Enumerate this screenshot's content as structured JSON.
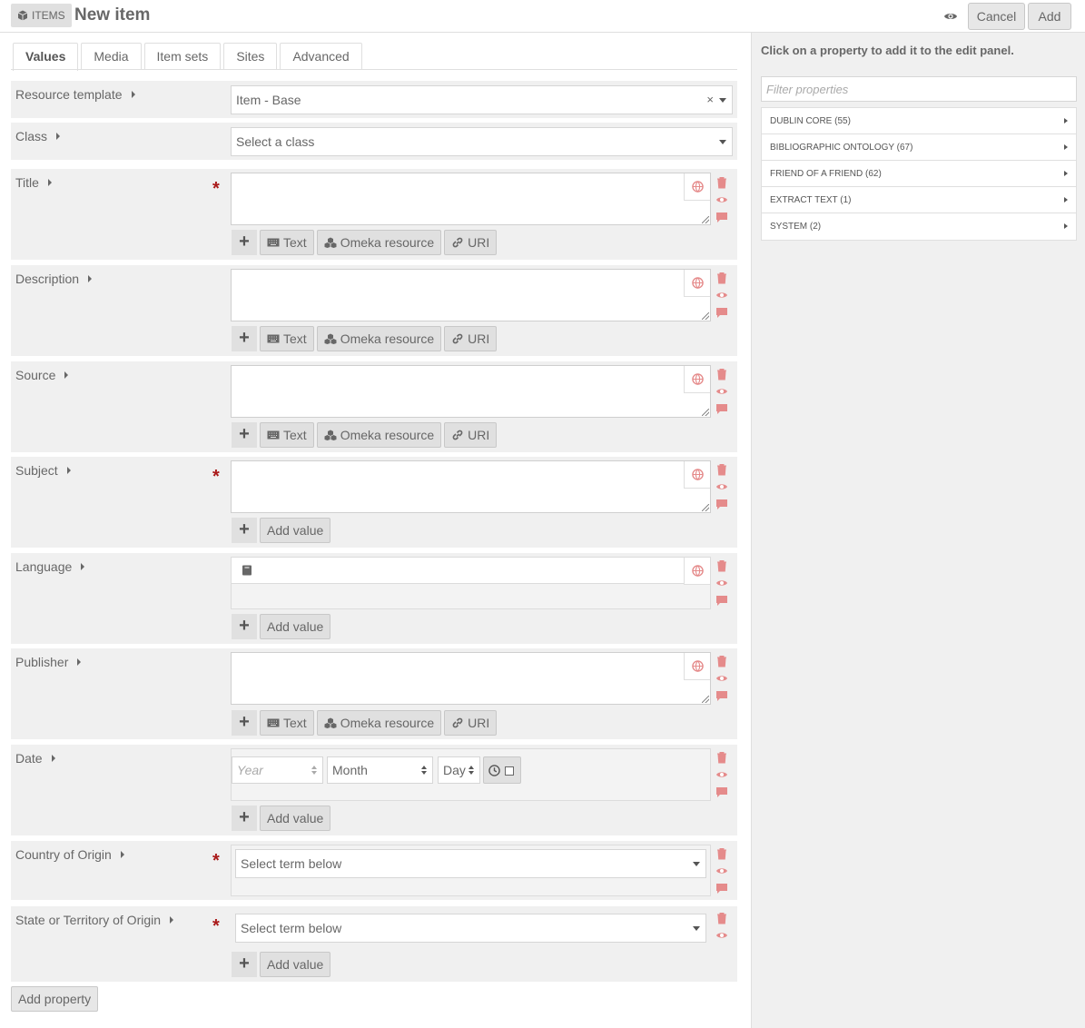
{
  "header": {
    "section_label": "ITEMS",
    "page_title": "New item",
    "cancel_label": "Cancel",
    "add_label": "Add"
  },
  "tabs": [
    {
      "label": "Values",
      "active": true
    },
    {
      "label": "Media"
    },
    {
      "label": "Item sets"
    },
    {
      "label": "Sites"
    },
    {
      "label": "Advanced"
    }
  ],
  "form": {
    "resource_template": {
      "label": "Resource template",
      "value": "Item - Base",
      "clear": "×"
    },
    "class": {
      "label": "Class",
      "placeholder": "Select a class"
    },
    "required_mark": "*",
    "properties": {
      "title": {
        "label": "Title"
      },
      "description": {
        "label": "Description"
      },
      "source": {
        "label": "Source"
      },
      "subject": {
        "label": "Subject"
      },
      "language": {
        "label": "Language"
      },
      "publisher": {
        "label": "Publisher"
      },
      "date": {
        "label": "Date",
        "year_placeholder": "Year",
        "month_value": "Month",
        "day_value": "Day"
      },
      "country": {
        "label": "Country of Origin",
        "value": "Select term below"
      },
      "state": {
        "label": "State or Territory of Origin",
        "value": "Select term below"
      }
    },
    "value_buttons": {
      "plus": "+",
      "text": "Text",
      "resource": "Omeka resource",
      "uri": "URI",
      "add_value": "Add value"
    },
    "add_property_label": "Add property"
  },
  "sidebar": {
    "hint": "Click on a property to add it to the edit panel.",
    "filter_placeholder": "Filter properties",
    "vocabularies": [
      {
        "label": "DUBLIN CORE (55)"
      },
      {
        "label": "BIBLIOGRAPHIC ONTOLOGY (67)"
      },
      {
        "label": "FRIEND OF A FRIEND (62)"
      },
      {
        "label": "EXTRACT TEXT (1)"
      },
      {
        "label": "SYSTEM (2)"
      }
    ]
  },
  "colors": {
    "accent_red": "#a91919",
    "icon_pink": "#e58b8b",
    "panel_gray": "#f0f0f0"
  }
}
